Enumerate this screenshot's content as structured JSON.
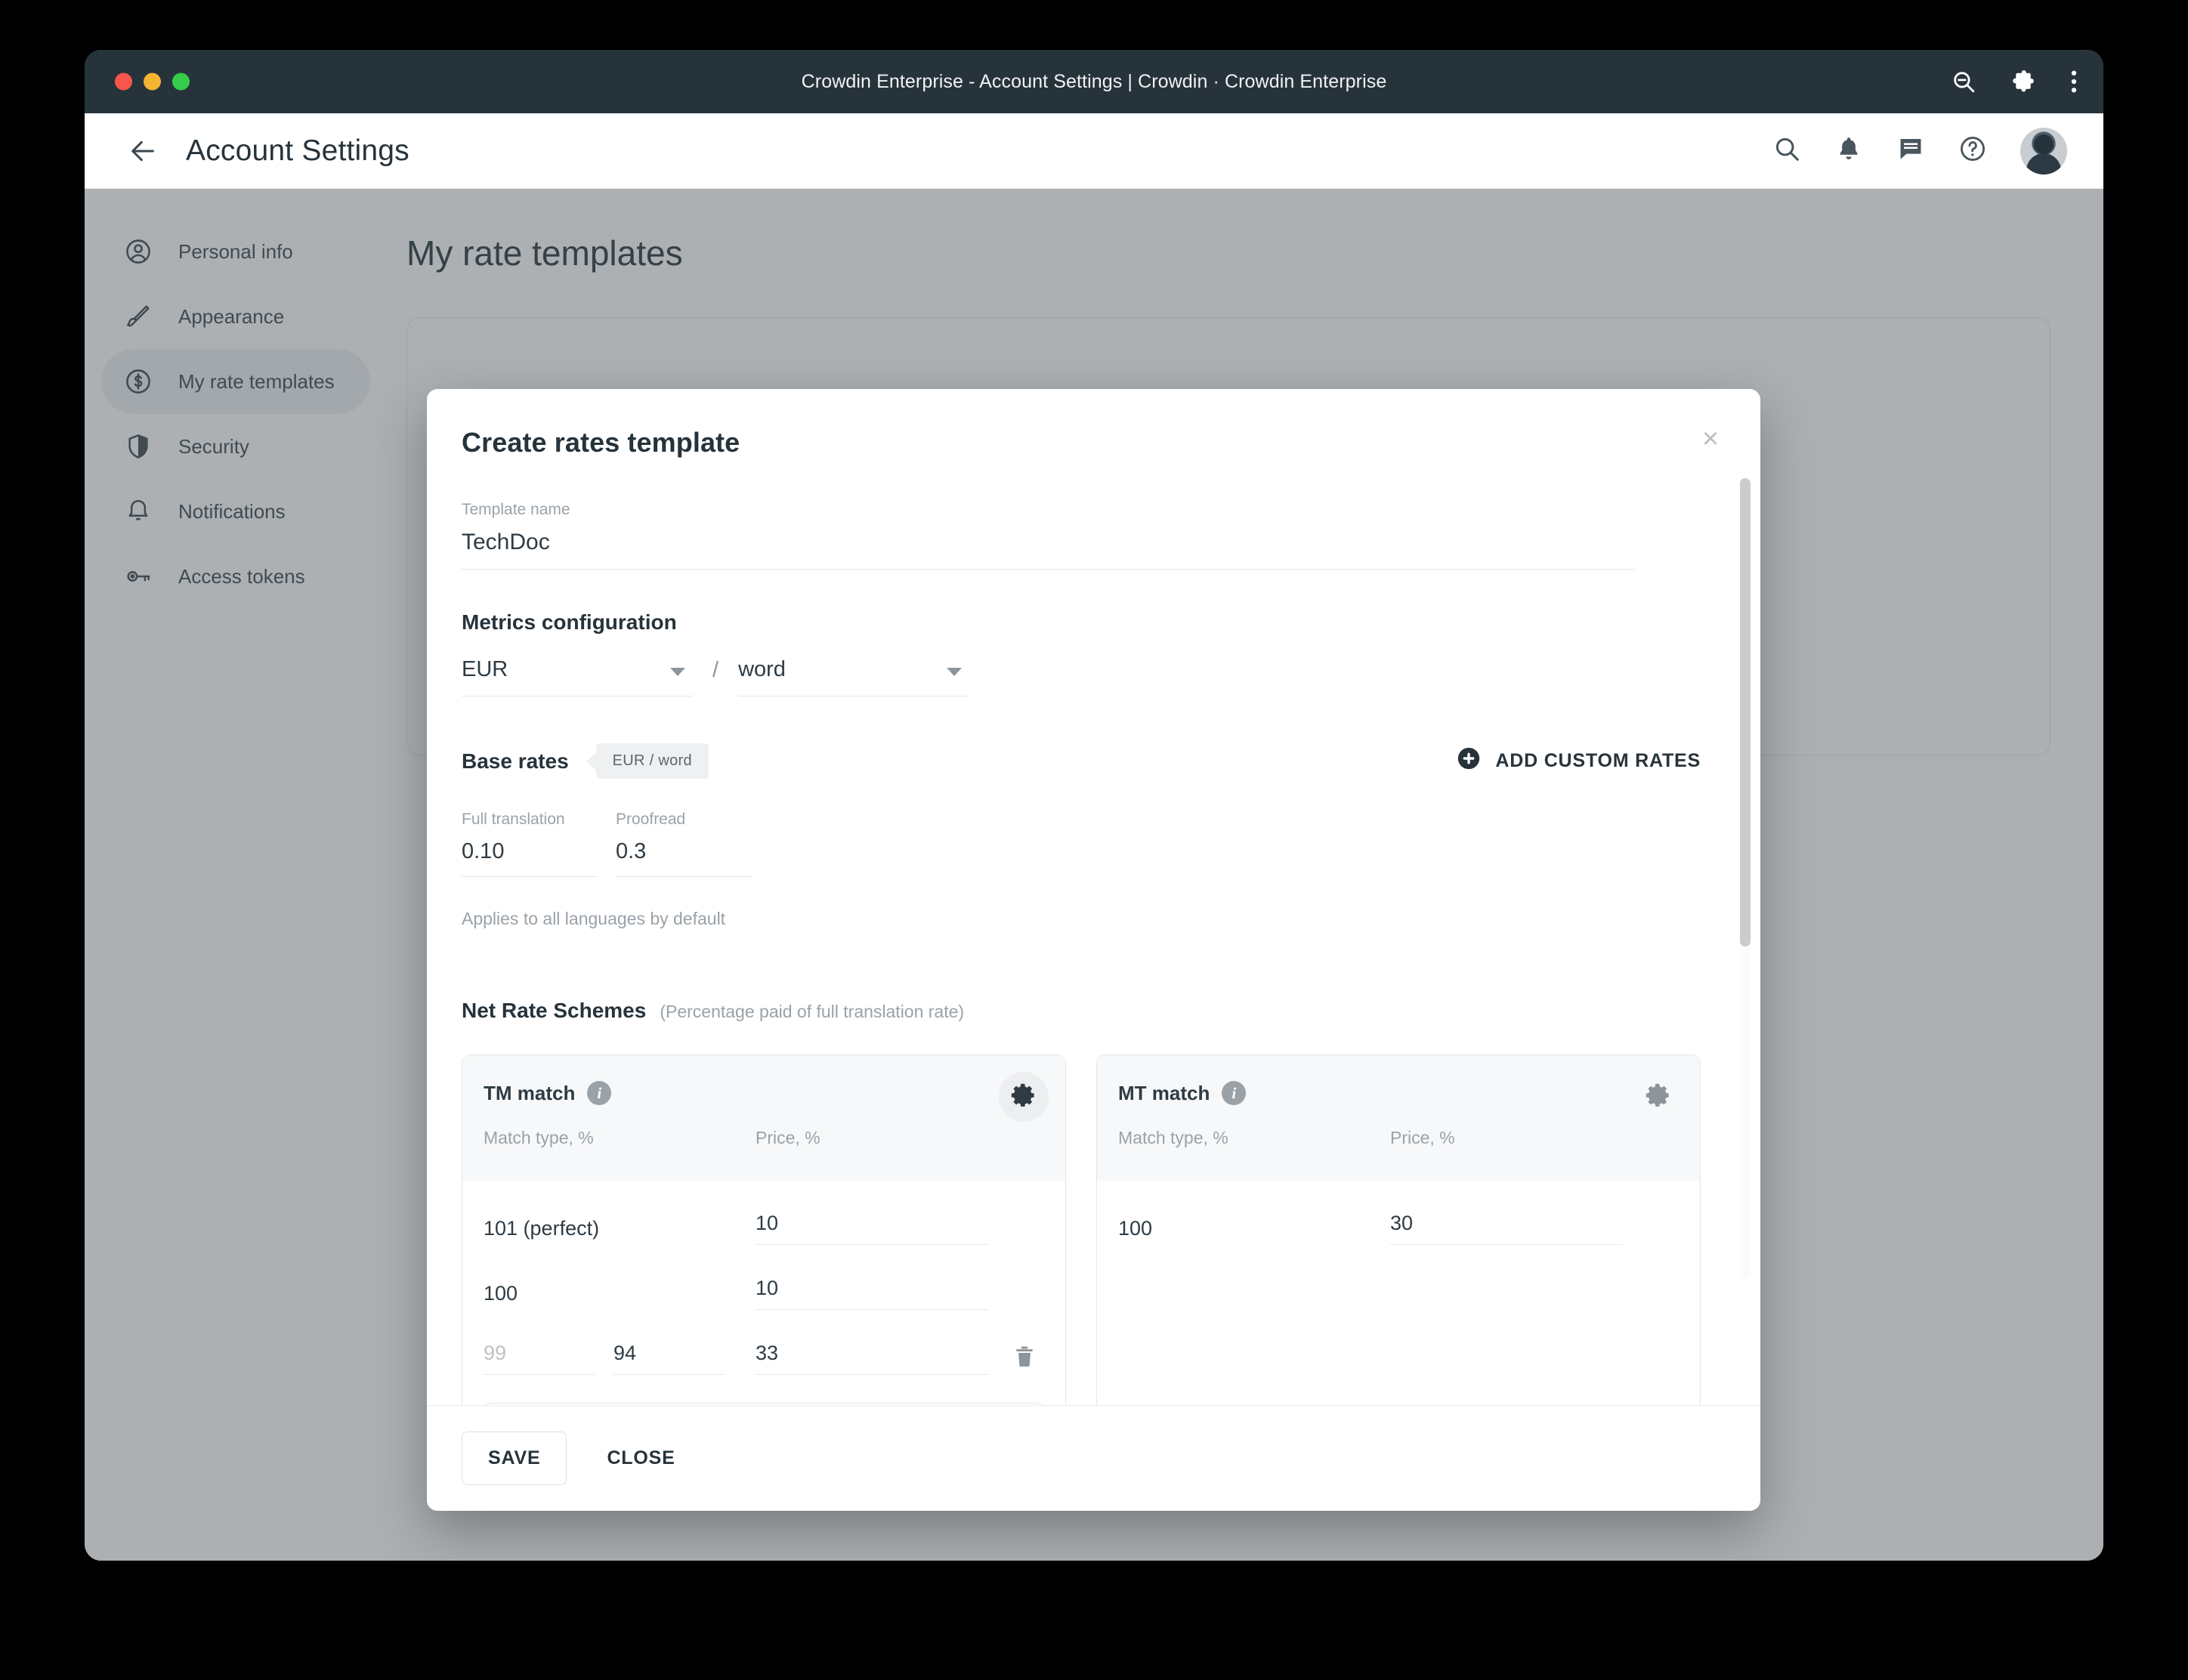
{
  "browser": {
    "window_title": "Crowdin Enterprise - Account Settings | Crowdin · Crowdin Enterprise",
    "actions": [
      {
        "name": "zoom-out-icon",
        "label": "Zoom out"
      },
      {
        "name": "extensions-icon",
        "label": "Extensions"
      },
      {
        "name": "browser-menu-icon",
        "label": "Menu"
      }
    ]
  },
  "app_header": {
    "back_label": "Back",
    "title": "Account Settings",
    "icons": [
      {
        "name": "search-icon",
        "label": "Search"
      },
      {
        "name": "bell-icon",
        "label": "Notifications"
      },
      {
        "name": "chat-icon",
        "label": "Messages"
      },
      {
        "name": "help-icon",
        "label": "Help"
      },
      {
        "name": "avatar",
        "label": "Account"
      }
    ]
  },
  "sidebar": {
    "items": [
      {
        "label": "Personal info",
        "icon": "person-icon",
        "active": false
      },
      {
        "label": "Appearance",
        "icon": "brush-icon",
        "active": false
      },
      {
        "label": "My rate templates",
        "icon": "dollar-coin-icon",
        "active": true
      },
      {
        "label": "Security",
        "icon": "shield-icon",
        "active": false
      },
      {
        "label": "Notifications",
        "icon": "bell-icon",
        "active": false
      },
      {
        "label": "Access tokens",
        "icon": "key-icon",
        "active": false
      }
    ]
  },
  "main": {
    "heading": "My rate templates"
  },
  "modal": {
    "title": "Create rates template",
    "close_label": "×",
    "template_name": {
      "label": "Template name",
      "value": "TechDoc"
    },
    "metrics": {
      "title": "Metrics configuration",
      "currency": "EUR",
      "separator": "/",
      "unit": "word"
    },
    "base_rates": {
      "title": "Base rates",
      "badge": "EUR / word",
      "add_custom_label": "ADD CUSTOM RATES",
      "fields": [
        {
          "label": "Full translation",
          "value": "0.10"
        },
        {
          "label": "Proofread",
          "value": "0.3"
        }
      ],
      "note": "Applies to all languages by default"
    },
    "net_rate_schemes": {
      "title": "Net Rate Schemes",
      "subtitle": "(Percentage paid of full translation rate)",
      "columns": {
        "match": "Match type, %",
        "price": "Price, %"
      },
      "cards": [
        {
          "title": "TM match",
          "info": "i",
          "gear_hovered": true,
          "rows": [
            {
              "match": "101 (perfect)",
              "range_from": "",
              "range_to": "",
              "price": "10",
              "editable": false,
              "deletable": false
            },
            {
              "match": "100",
              "range_from": "",
              "range_to": "",
              "price": "10",
              "editable": false,
              "deletable": false
            },
            {
              "match": "",
              "range_from": "99",
              "range_to": "94",
              "price": "33",
              "editable": true,
              "deletable": true
            }
          ],
          "add_row": "+"
        },
        {
          "title": "MT match",
          "info": "i",
          "gear_hovered": false,
          "rows": [
            {
              "match": "100",
              "range_from": "",
              "range_to": "",
              "price": "30",
              "editable": false,
              "deletable": false
            }
          ],
          "add_row": ""
        }
      ]
    },
    "footer": {
      "save_label": "SAVE",
      "close_label": "CLOSE"
    }
  }
}
